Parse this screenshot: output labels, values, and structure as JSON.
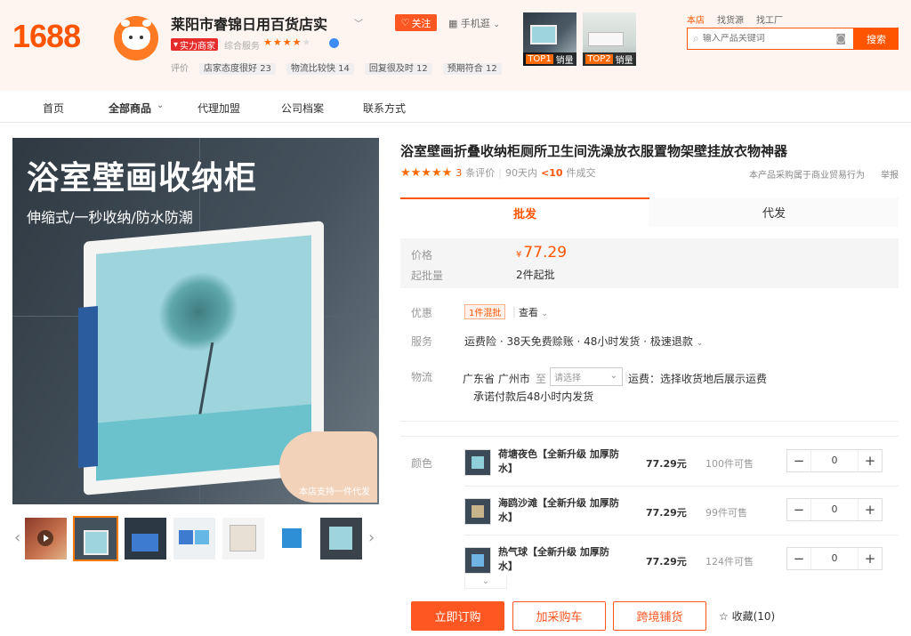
{
  "header": {
    "logo": "1688",
    "shop_name": "莱阳市睿锦日用百货店实",
    "follow_label": "关注",
    "mobile_label": "手机逛",
    "shop_tag": "实力商家",
    "combined_service_label": "综合服务",
    "combined_service_stars": 4,
    "rating_label": "评价",
    "ratings": [
      {
        "label": "店家态度很好",
        "count": "23"
      },
      {
        "label": "物流比较快",
        "count": "14"
      },
      {
        "label": "回复很及时",
        "count": "12"
      },
      {
        "label": "预期符合",
        "count": "12"
      }
    ],
    "top_products": [
      {
        "rank": "TOP1",
        "label": "销量"
      },
      {
        "rank": "TOP2",
        "label": "销量"
      }
    ],
    "search_tabs": [
      "本店",
      "找货源",
      "找工厂"
    ],
    "search_placeholder": "输入产品关键词",
    "search_button": "搜索"
  },
  "nav": {
    "items": [
      {
        "label": "首页"
      },
      {
        "label": "全部商品"
      },
      {
        "label": "代理加盟"
      },
      {
        "label": "公司档案"
      },
      {
        "label": "联系方式"
      }
    ]
  },
  "gallery": {
    "hero_title": "浴室壁画收纳柜",
    "hero_subtitle": "伸缩式/一秒收纳/防水防潮",
    "hero_footnote": "本店支持一件代发"
  },
  "product": {
    "title": "浴室壁画折叠收纳柜厕所卫生间洗澡放衣服置物架壁挂放衣物神器",
    "stars": 5,
    "review_count": "3",
    "review_label": "条评价",
    "period_label": "90天内",
    "sold_count": "<10",
    "sold_label": "件成交",
    "business_note": "本产品采购属于商业贸易行为",
    "report_label": "举报",
    "tabs": [
      {
        "label": "批发",
        "active": true
      },
      {
        "label": "代发",
        "active": false
      }
    ],
    "price_label": "价格",
    "currency": "¥",
    "price": "77.29",
    "moq_label": "起批量",
    "moq_value": "2件起批",
    "promo_label": "优惠",
    "promo_chip": "1件混批",
    "promo_view": "查看",
    "service_label": "服务",
    "service_text": "运费险 · 38天免费赊账 · 48小时发货 · 极速退款",
    "logistics_label": "物流",
    "ship_from": "广东省 广州市",
    "ship_to_label": "至",
    "ship_select_placeholder": "请选择",
    "ship_fee": "运费：选择收货地后展示运费",
    "ship_promise": "承诺付款后48小时内发货",
    "color_label": "颜色",
    "variants": [
      {
        "name": "荷塘夜色【全新升级 加厚防水】",
        "price": "77.29元",
        "stock": "100件可售",
        "qty": "0"
      },
      {
        "name": "海鸥沙滩【全新升级 加厚防水】",
        "price": "77.29元",
        "stock": "99件可售",
        "qty": "0"
      },
      {
        "name": "热气球【全新升级 加厚防水】",
        "price": "77.29元",
        "stock": "124件可售",
        "qty": "0"
      }
    ],
    "actions": {
      "order": "立即订购",
      "cart": "加采购车",
      "cross_border": "跨境铺货",
      "favorite": "收藏(10)"
    }
  },
  "colors": {
    "accent": "#ff5500",
    "button": "#ff5722"
  }
}
